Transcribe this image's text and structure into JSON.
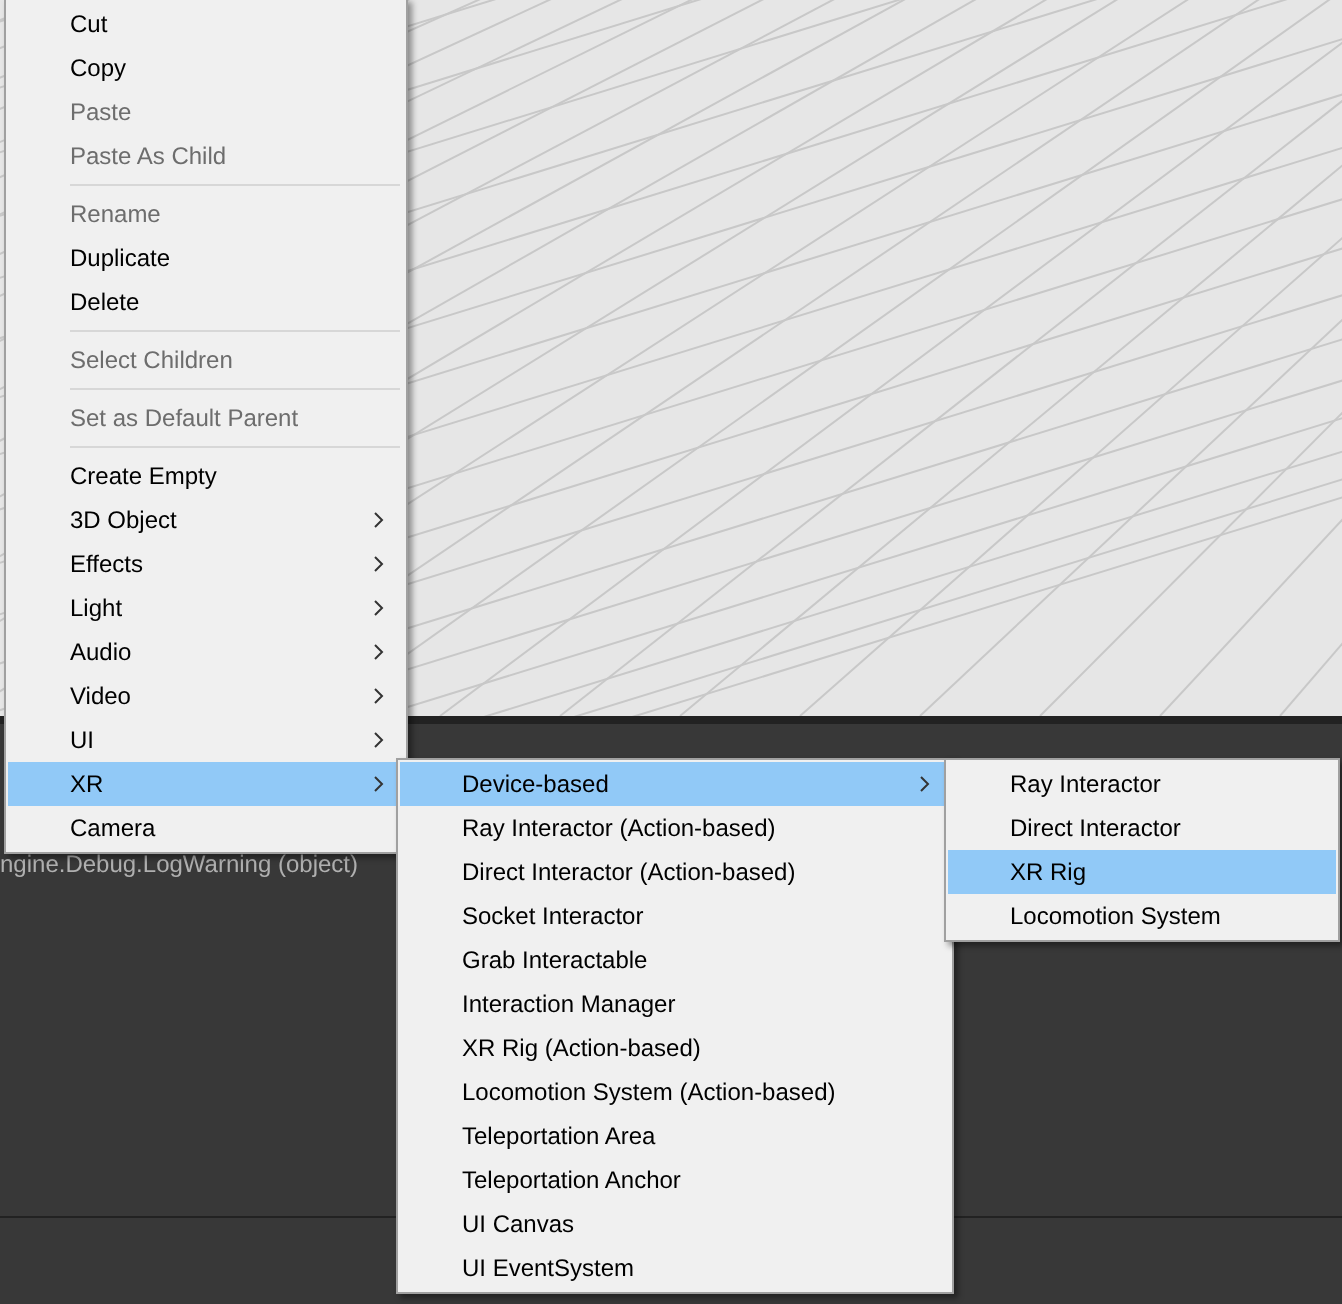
{
  "console": {
    "line": "ngine.Debug.LogWarning (object)"
  },
  "context_menu": {
    "items": [
      {
        "kind": "item",
        "label": "Cut",
        "disabled": false,
        "selected": false,
        "submenu": false
      },
      {
        "kind": "item",
        "label": "Copy",
        "disabled": false,
        "selected": false,
        "submenu": false
      },
      {
        "kind": "item",
        "label": "Paste",
        "disabled": true,
        "selected": false,
        "submenu": false
      },
      {
        "kind": "item",
        "label": "Paste As Child",
        "disabled": true,
        "selected": false,
        "submenu": false
      },
      {
        "kind": "separator"
      },
      {
        "kind": "item",
        "label": "Rename",
        "disabled": true,
        "selected": false,
        "submenu": false
      },
      {
        "kind": "item",
        "label": "Duplicate",
        "disabled": false,
        "selected": false,
        "submenu": false
      },
      {
        "kind": "item",
        "label": "Delete",
        "disabled": false,
        "selected": false,
        "submenu": false
      },
      {
        "kind": "separator"
      },
      {
        "kind": "item",
        "label": "Select Children",
        "disabled": true,
        "selected": false,
        "submenu": false
      },
      {
        "kind": "separator"
      },
      {
        "kind": "item",
        "label": "Set as Default Parent",
        "disabled": true,
        "selected": false,
        "submenu": false
      },
      {
        "kind": "separator"
      },
      {
        "kind": "item",
        "label": "Create Empty",
        "disabled": false,
        "selected": false,
        "submenu": false
      },
      {
        "kind": "item",
        "label": "3D Object",
        "disabled": false,
        "selected": false,
        "submenu": true
      },
      {
        "kind": "item",
        "label": "Effects",
        "disabled": false,
        "selected": false,
        "submenu": true
      },
      {
        "kind": "item",
        "label": "Light",
        "disabled": false,
        "selected": false,
        "submenu": true
      },
      {
        "kind": "item",
        "label": "Audio",
        "disabled": false,
        "selected": false,
        "submenu": true
      },
      {
        "kind": "item",
        "label": "Video",
        "disabled": false,
        "selected": false,
        "submenu": true
      },
      {
        "kind": "item",
        "label": "UI",
        "disabled": false,
        "selected": false,
        "submenu": true
      },
      {
        "kind": "item",
        "label": "XR",
        "disabled": false,
        "selected": true,
        "submenu": true
      },
      {
        "kind": "item",
        "label": "Camera",
        "disabled": false,
        "selected": false,
        "submenu": false
      }
    ]
  },
  "xr_submenu": {
    "items": [
      {
        "kind": "item",
        "label": "Device-based",
        "disabled": false,
        "selected": true,
        "submenu": true
      },
      {
        "kind": "item",
        "label": "Ray Interactor (Action-based)",
        "disabled": false,
        "selected": false,
        "submenu": false
      },
      {
        "kind": "item",
        "label": "Direct Interactor (Action-based)",
        "disabled": false,
        "selected": false,
        "submenu": false
      },
      {
        "kind": "item",
        "label": "Socket Interactor",
        "disabled": false,
        "selected": false,
        "submenu": false
      },
      {
        "kind": "item",
        "label": "Grab Interactable",
        "disabled": false,
        "selected": false,
        "submenu": false
      },
      {
        "kind": "item",
        "label": "Interaction Manager",
        "disabled": false,
        "selected": false,
        "submenu": false
      },
      {
        "kind": "item",
        "label": "XR Rig (Action-based)",
        "disabled": false,
        "selected": false,
        "submenu": false
      },
      {
        "kind": "item",
        "label": "Locomotion System (Action-based)",
        "disabled": false,
        "selected": false,
        "submenu": false
      },
      {
        "kind": "item",
        "label": "Teleportation Area",
        "disabled": false,
        "selected": false,
        "submenu": false
      },
      {
        "kind": "item",
        "label": "Teleportation Anchor",
        "disabled": false,
        "selected": false,
        "submenu": false
      },
      {
        "kind": "item",
        "label": "UI Canvas",
        "disabled": false,
        "selected": false,
        "submenu": false
      },
      {
        "kind": "item",
        "label": "UI EventSystem",
        "disabled": false,
        "selected": false,
        "submenu": false
      }
    ]
  },
  "device_submenu": {
    "items": [
      {
        "kind": "item",
        "label": "Ray Interactor",
        "disabled": false,
        "selected": false,
        "submenu": false
      },
      {
        "kind": "item",
        "label": "Direct Interactor",
        "disabled": false,
        "selected": false,
        "submenu": false
      },
      {
        "kind": "item",
        "label": "XR Rig",
        "disabled": false,
        "selected": true,
        "submenu": false
      },
      {
        "kind": "item",
        "label": "Locomotion System",
        "disabled": false,
        "selected": false,
        "submenu": false
      }
    ]
  }
}
